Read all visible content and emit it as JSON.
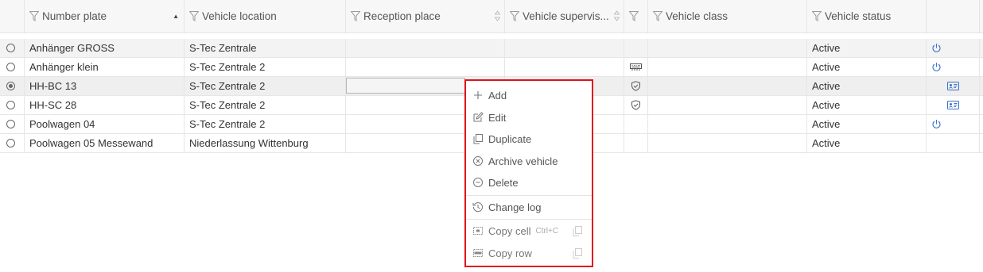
{
  "columns": [
    {
      "key": "plate",
      "label": "Number plate",
      "sorted": "asc"
    },
    {
      "key": "location",
      "label": "Vehicle location"
    },
    {
      "key": "reception",
      "label": "Reception place"
    },
    {
      "key": "supervisor",
      "label": "Vehicle supervis..."
    },
    {
      "key": "class",
      "label": "Vehicle class"
    },
    {
      "key": "status",
      "label": "Vehicle status"
    }
  ],
  "rows": [
    {
      "plate": "Anhänger GROSS",
      "location": "S-Tec Zentrale",
      "reception": "",
      "supervisor": "",
      "class": "",
      "status": "Active",
      "selected": false,
      "flag_icon": "",
      "action_icon": "power-icon"
    },
    {
      "plate": "Anhänger klein",
      "location": "S-Tec Zentrale 2",
      "reception": "",
      "supervisor": "",
      "class": "",
      "status": "Active",
      "selected": false,
      "flag_icon": "keyboard-icon",
      "action_icon": "power-icon"
    },
    {
      "plate": "HH-BC 13",
      "location": "S-Tec Zentrale 2",
      "reception": "",
      "supervisor": "",
      "class": "",
      "status": "Active",
      "selected": true,
      "flag_icon": "shield-check-icon",
      "action_icon": "id-card-icon"
    },
    {
      "plate": "HH-SC 28",
      "location": "S-Tec Zentrale 2",
      "reception": "",
      "supervisor": "",
      "class": "",
      "status": "Active",
      "selected": false,
      "flag_icon": "shield-check-icon",
      "action_icon": "id-card-icon"
    },
    {
      "plate": "Poolwagen 04",
      "location": "S-Tec Zentrale 2",
      "reception": "",
      "supervisor": "",
      "class": "",
      "status": "Active",
      "selected": false,
      "flag_icon": "",
      "action_icon": "power-icon"
    },
    {
      "plate": "Poolwagen 05 Messewand",
      "location": "Niederlassung Wittenburg",
      "reception": "",
      "supervisor": "",
      "class": "",
      "status": "Active",
      "selected": false,
      "flag_icon": "",
      "action_icon": ""
    }
  ],
  "context_menu": {
    "add": "Add",
    "edit": "Edit",
    "duplicate": "Duplicate",
    "archive": "Archive vehicle",
    "delete": "Delete",
    "change_log": "Change log",
    "copy_cell": "Copy cell",
    "copy_cell_shortcut": "Ctrl+C",
    "copy_row": "Copy row",
    "highlight_color": "#e0121b"
  },
  "colors": {
    "header_bg": "#f7f7f8",
    "selected_row_bg": "#efefef",
    "accent_blue": "#3a73c9",
    "text": "#333333"
  }
}
